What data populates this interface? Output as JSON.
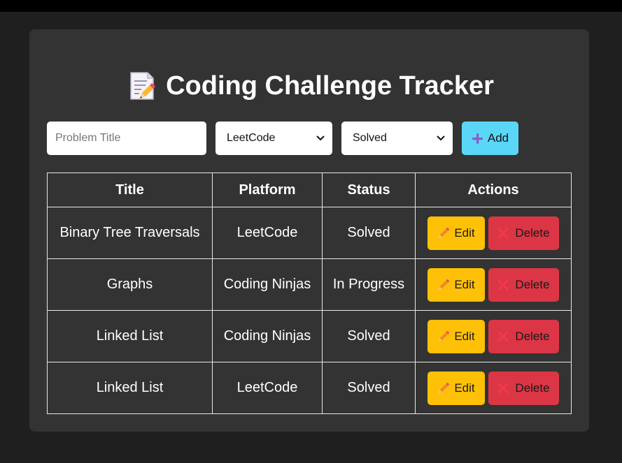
{
  "app": {
    "title": "Coding Challenge Tracker",
    "title_icon": "memo-icon"
  },
  "form": {
    "title_placeholder": "Problem Title",
    "title_value": "",
    "platform_selected": "LeetCode",
    "status_selected": "Solved",
    "add_label": "Add",
    "add_icon": "plus-icon",
    "add_color": "#5ad7f7"
  },
  "table": {
    "headers": {
      "title": "Title",
      "platform": "Platform",
      "status": "Status",
      "actions": "Actions"
    },
    "rows": [
      {
        "title": "Binary Tree Traversals",
        "platform": "LeetCode",
        "status": "Solved"
      },
      {
        "title": "Graphs",
        "platform": "Coding Ninjas",
        "status": "In Progress"
      },
      {
        "title": "Linked List",
        "platform": "Coding Ninjas",
        "status": "Solved"
      },
      {
        "title": "Linked List",
        "platform": "LeetCode",
        "status": "Solved"
      }
    ],
    "edit_label": "Edit",
    "delete_label": "Delete",
    "edit_icon": "pencil-icon",
    "delete_icon": "cross-icon",
    "edit_color": "#ffc107",
    "delete_color": "#dc3545"
  },
  "colors": {
    "background": "#1f1f1f",
    "card": "#333333",
    "text": "#ffffff"
  }
}
